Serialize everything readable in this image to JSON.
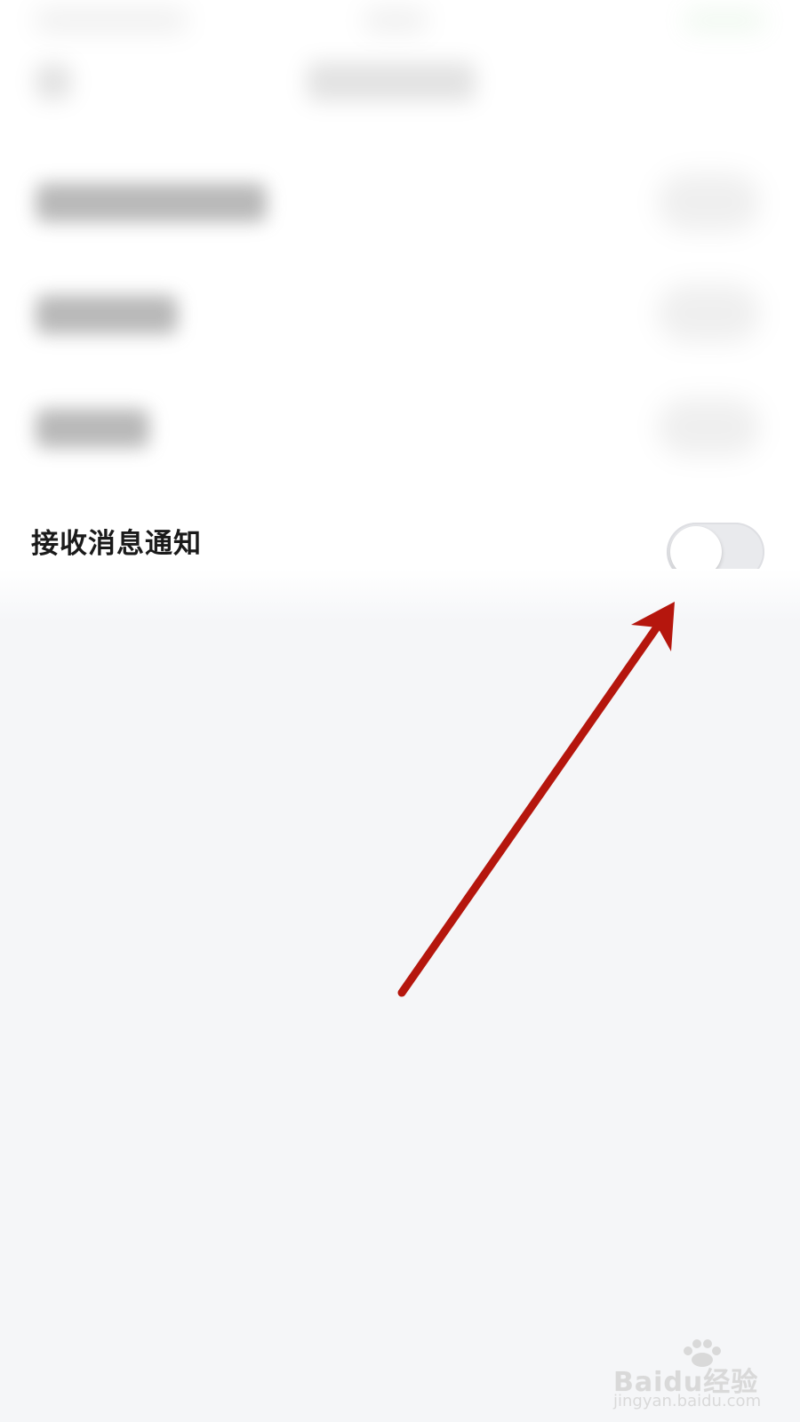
{
  "settings": {
    "notification_row": {
      "label": "接收消息通知",
      "toggle_on": false
    }
  },
  "watermark": {
    "brand_text": "Baidu经验",
    "url_text": "jingyan.baidu.com"
  },
  "colors": {
    "arrow": "#b5160d",
    "background": "#f5f6f8",
    "toggle_track": "#e9eaed"
  },
  "icons": {
    "watermark": "baidu-paw-icon"
  }
}
